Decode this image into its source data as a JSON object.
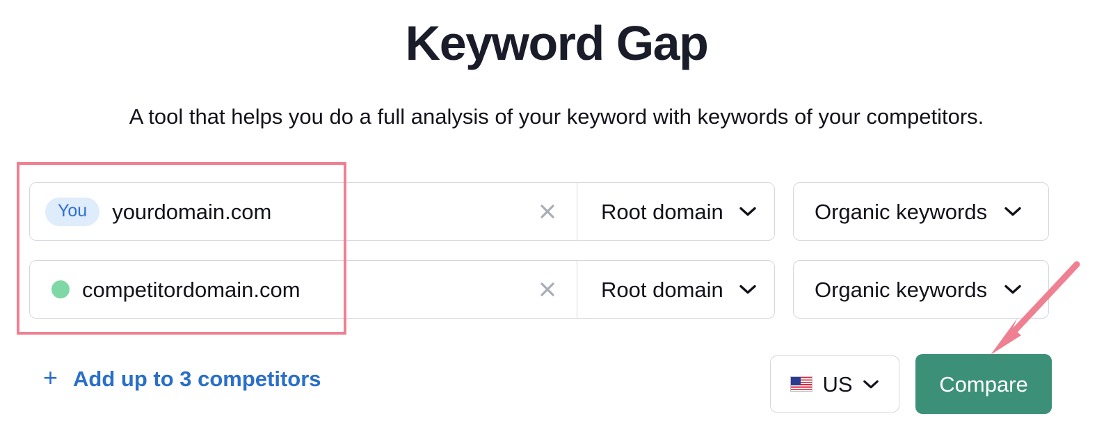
{
  "header": {
    "title": "Keyword Gap",
    "subtitle": "A tool that helps you do a full analysis of your keyword with keywords of your competitors."
  },
  "rows": [
    {
      "badge_label": "You",
      "marker": "you-badge",
      "domain_value": "yourdomain.com",
      "domain_placeholder": "Enter domain",
      "clear_icon": "close-icon",
      "scope_value": "Root domain",
      "scope_icon": "chevron-down-icon",
      "keyword_type_value": "Organic keywords",
      "keyword_type_icon": "chevron-down-icon"
    },
    {
      "badge_label": "",
      "marker": "green-dot",
      "domain_value": "competitordomain.com",
      "domain_placeholder": "Enter domain",
      "clear_icon": "close-icon",
      "scope_value": "Root domain",
      "scope_icon": "chevron-down-icon",
      "keyword_type_value": "Organic keywords",
      "keyword_type_icon": "chevron-down-icon"
    }
  ],
  "actions": {
    "add_competitors_label": "Add up to 3 competitors",
    "add_competitors_icon": "plus-icon",
    "country_value": "US",
    "country_flag_icon": "us-flag-icon",
    "country_icon": "chevron-down-icon",
    "compare_label": "Compare"
  },
  "annotations": {
    "highlight_box": "domain-inputs-highlight",
    "arrow": "arrow-pointing-to-compare"
  },
  "colors": {
    "title": "#1a1d29",
    "accent_blue": "#2a6fc9",
    "badge_bg": "#dfecfb",
    "badge_text": "#2f6fd0",
    "dot_green": "#7dd8a5",
    "compare_green": "#3d9078",
    "annotation_pink": "#ef8091",
    "border": "#d4d7de"
  }
}
